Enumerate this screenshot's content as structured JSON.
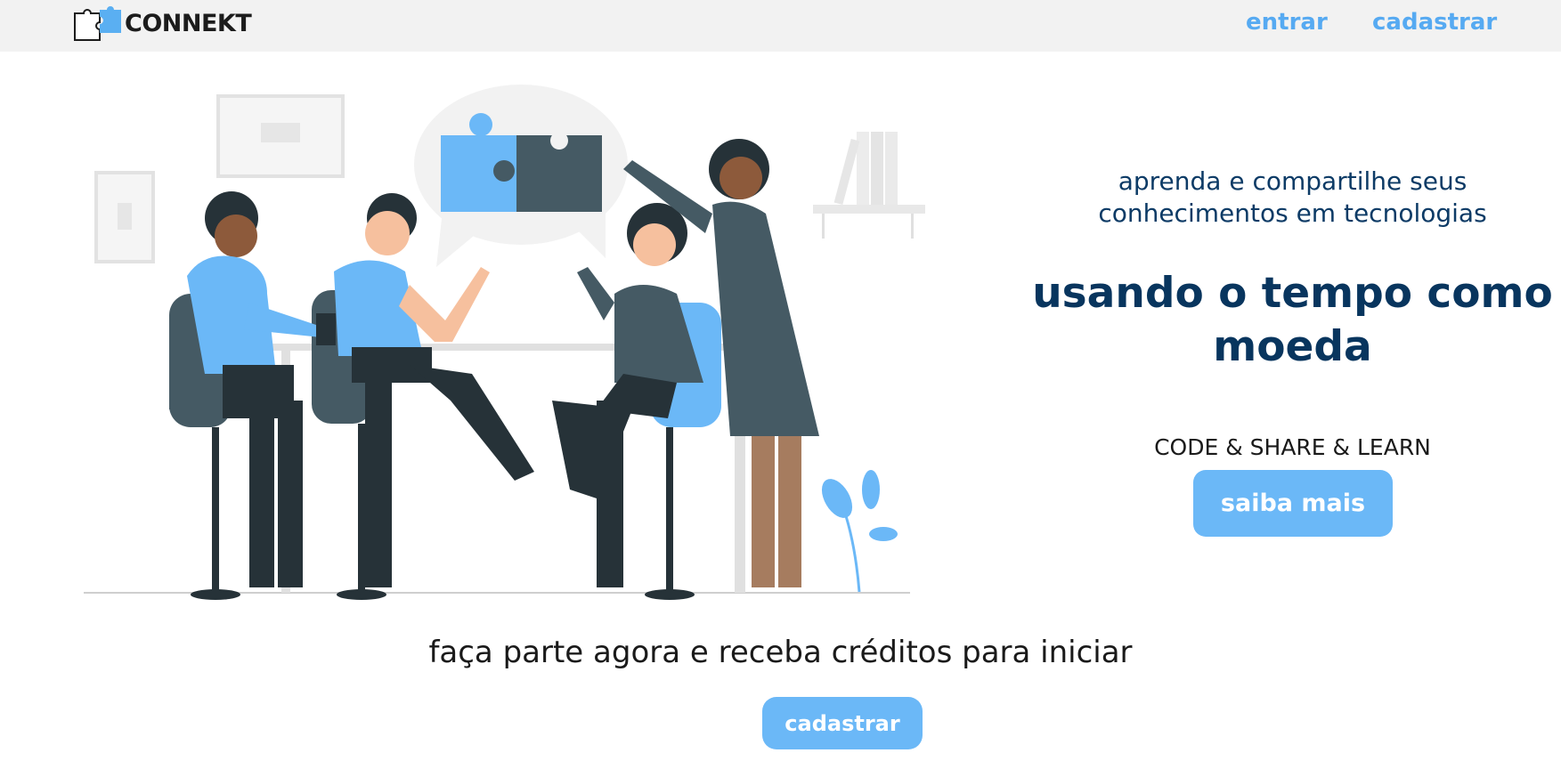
{
  "brand": {
    "name": "CONNEKT",
    "logo_icon": "puzzle-pieces-icon",
    "accent_color": "#56aaf2",
    "dark_text_color": "#08355e"
  },
  "nav": {
    "login_label": "entrar",
    "signup_label": "cadastrar"
  },
  "hero": {
    "illustration": "team-collaboration-illustration",
    "subtitle": "aprenda e compartilhe seus conhecimentos em tecnologias",
    "title": "usando o tempo como moeda",
    "tagline": "CODE & SHARE & LEARN",
    "cta_label": "saiba mais"
  },
  "footer_cta": {
    "text": "faça parte agora e receba créditos para iniciar",
    "button_label": "cadastrar"
  }
}
